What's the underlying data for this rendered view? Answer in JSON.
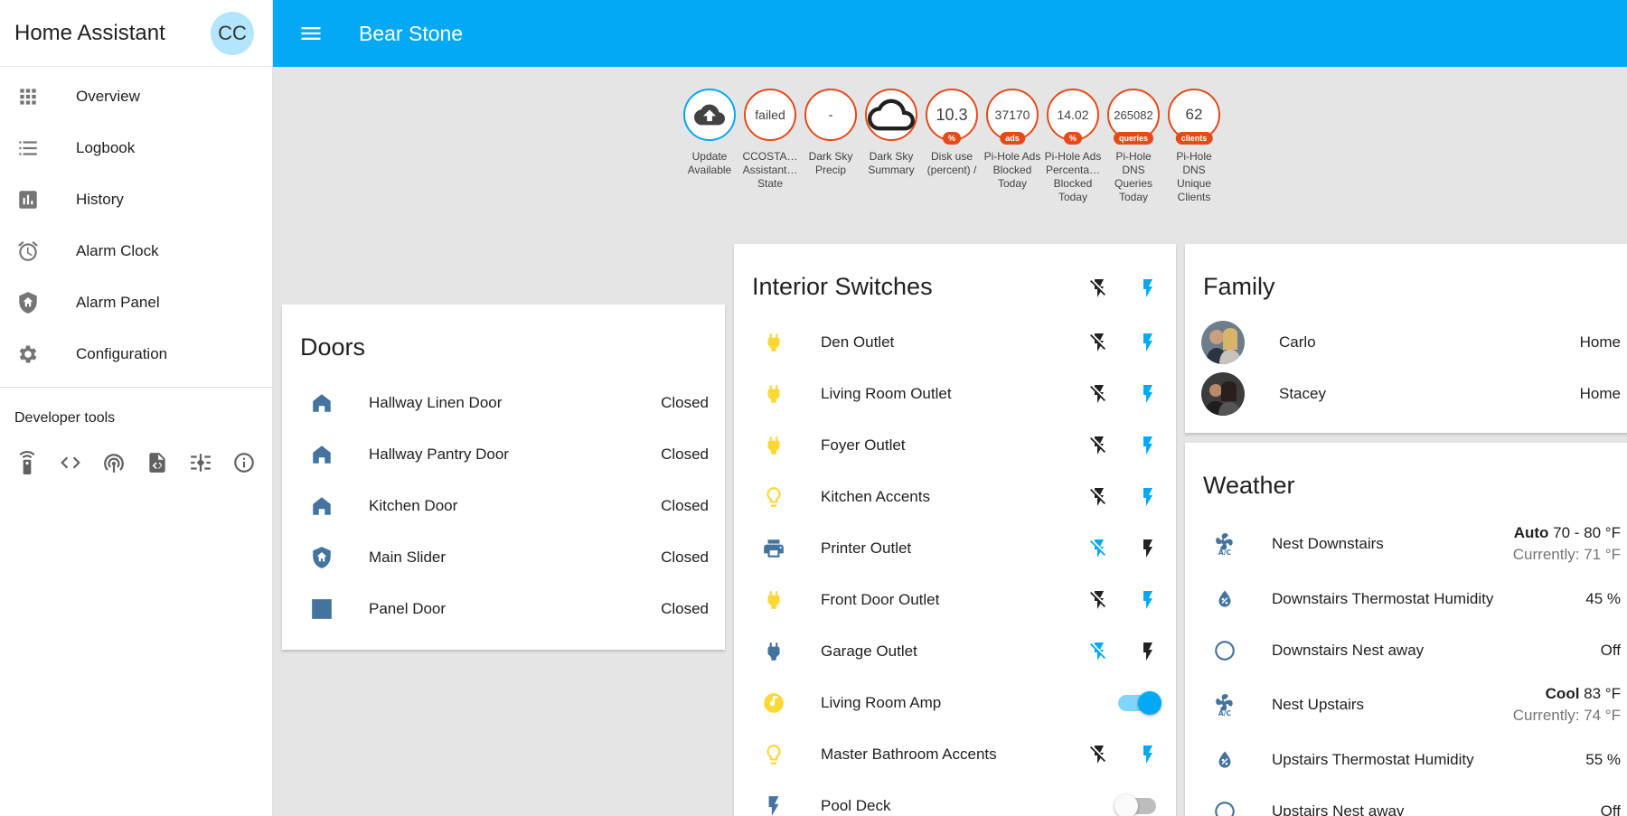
{
  "app": {
    "title": "Home Assistant",
    "user_initials": "CC"
  },
  "sidebar": {
    "items": [
      {
        "label": "Overview"
      },
      {
        "label": "Logbook"
      },
      {
        "label": "History"
      },
      {
        "label": "Alarm Clock"
      },
      {
        "label": "Alarm Panel"
      },
      {
        "label": "Configuration"
      }
    ],
    "developer_tools_label": "Developer tools"
  },
  "toolbar": {
    "title": "Bear Stone"
  },
  "badges": [
    {
      "value": "",
      "unit": "",
      "label": "Update Available",
      "icon": "cloud-upload-icon"
    },
    {
      "value": "failed",
      "unit": "",
      "label": "CCOSTA… Assistant… State"
    },
    {
      "value": "-",
      "unit": "",
      "label": "Dark Sky Precip"
    },
    {
      "value": "",
      "unit": "",
      "label": "Dark Sky Summary",
      "icon": "cloud-icon"
    },
    {
      "value": "10.3",
      "unit": "%",
      "label": "Disk use (percent) /"
    },
    {
      "value": "37170",
      "unit": "ads",
      "label": "Pi-Hole Ads Blocked Today"
    },
    {
      "value": "14.02",
      "unit": "%",
      "label": "Pi-Hole Ads Percenta… Blocked Today"
    },
    {
      "value": "265082",
      "unit": "queries",
      "label": "Pi-Hole DNS Queries Today"
    },
    {
      "value": "62",
      "unit": "clients",
      "label": "Pi-Hole DNS Unique Clients"
    }
  ],
  "doors": {
    "title": "Doors",
    "rows": [
      {
        "name": "Hallway Linen Door",
        "state": "Closed"
      },
      {
        "name": "Hallway Pantry Door",
        "state": "Closed"
      },
      {
        "name": "Kitchen Door",
        "state": "Closed"
      },
      {
        "name": "Main Slider",
        "state": "Closed"
      },
      {
        "name": "Panel Door",
        "state": "Closed"
      }
    ]
  },
  "switches": {
    "title": "Interior Switches",
    "rows": [
      {
        "name": "Den Outlet"
      },
      {
        "name": "Living Room Outlet"
      },
      {
        "name": "Foyer Outlet"
      },
      {
        "name": "Kitchen Accents"
      },
      {
        "name": "Printer Outlet"
      },
      {
        "name": "Front Door Outlet"
      },
      {
        "name": "Garage Outlet"
      },
      {
        "name": "Living Room Amp"
      },
      {
        "name": "Master Bathroom Accents"
      },
      {
        "name": "Pool Deck"
      }
    ]
  },
  "family": {
    "title": "Family",
    "rows": [
      {
        "name": "Carlo",
        "state": "Home"
      },
      {
        "name": "Stacey",
        "state": "Home"
      }
    ]
  },
  "weather": {
    "title": "Weather",
    "rows": [
      {
        "name": "Nest Downstairs",
        "mode": "Auto",
        "target": "70 - 80 °F",
        "current": "Currently: 71 °F"
      },
      {
        "name": "Downstairs Thermostat Humidity",
        "state": "45 %"
      },
      {
        "name": "Downstairs Nest away",
        "state": "Off"
      },
      {
        "name": "Nest Upstairs",
        "mode": "Cool",
        "target": "83 °F",
        "current": "Currently: 74 °F"
      },
      {
        "name": "Upstairs Thermostat Humidity",
        "state": "55 %"
      },
      {
        "name": "Upstairs Nest away",
        "state": "Off"
      }
    ]
  },
  "colors": {
    "primary": "#03a9f4",
    "badge_border": "#e64a19",
    "door_icon": "#44739e",
    "light_on": "#fdd835"
  }
}
